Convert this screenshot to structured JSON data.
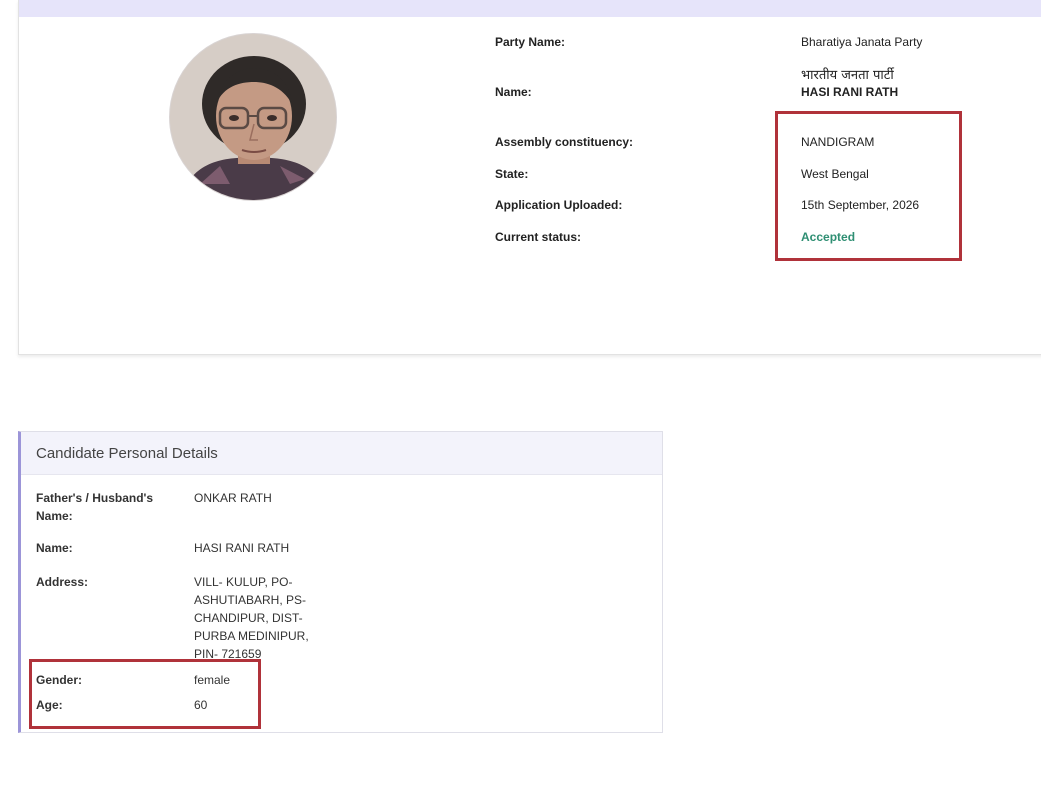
{
  "candidate": {
    "party_label": "Party Name:",
    "party_value": "Bharatiya Janata Party",
    "name_label": "Name:",
    "name_hindi": "भारतीय जनता पार्टी",
    "name_value": "HASI RANI RATH",
    "constituency_label": "Assembly constituency:",
    "constituency_value": "NANDIGRAM",
    "state_label": "State:",
    "state_value": "West Bengal",
    "uploaded_label": "Application Uploaded:",
    "uploaded_value": "15th September, 2026",
    "status_label": "Current status:",
    "status_value": "Accepted"
  },
  "colors": {
    "accent_strip": "#e6e4fa",
    "highlight_box": "#b0323a",
    "status_accepted": "#2f8f73",
    "panel_border_left": "#9c95d8"
  },
  "personal": {
    "title": "Candidate Personal Details",
    "father_label_1": "Father's / Husband's",
    "father_label_2": "Name:",
    "father_value": "ONKAR RATH",
    "name_label": "Name:",
    "name_value": "HASI RANI RATH",
    "address_label": "Address:",
    "address_lines": [
      "VILL- KULUP, PO-",
      "ASHUTIABARH, PS-",
      "CHANDIPUR, DIST-",
      "PURBA MEDINIPUR,",
      "PIN- 721659"
    ],
    "gender_label": "Gender:",
    "gender_value": "female",
    "age_label": "Age:",
    "age_value": "60"
  }
}
